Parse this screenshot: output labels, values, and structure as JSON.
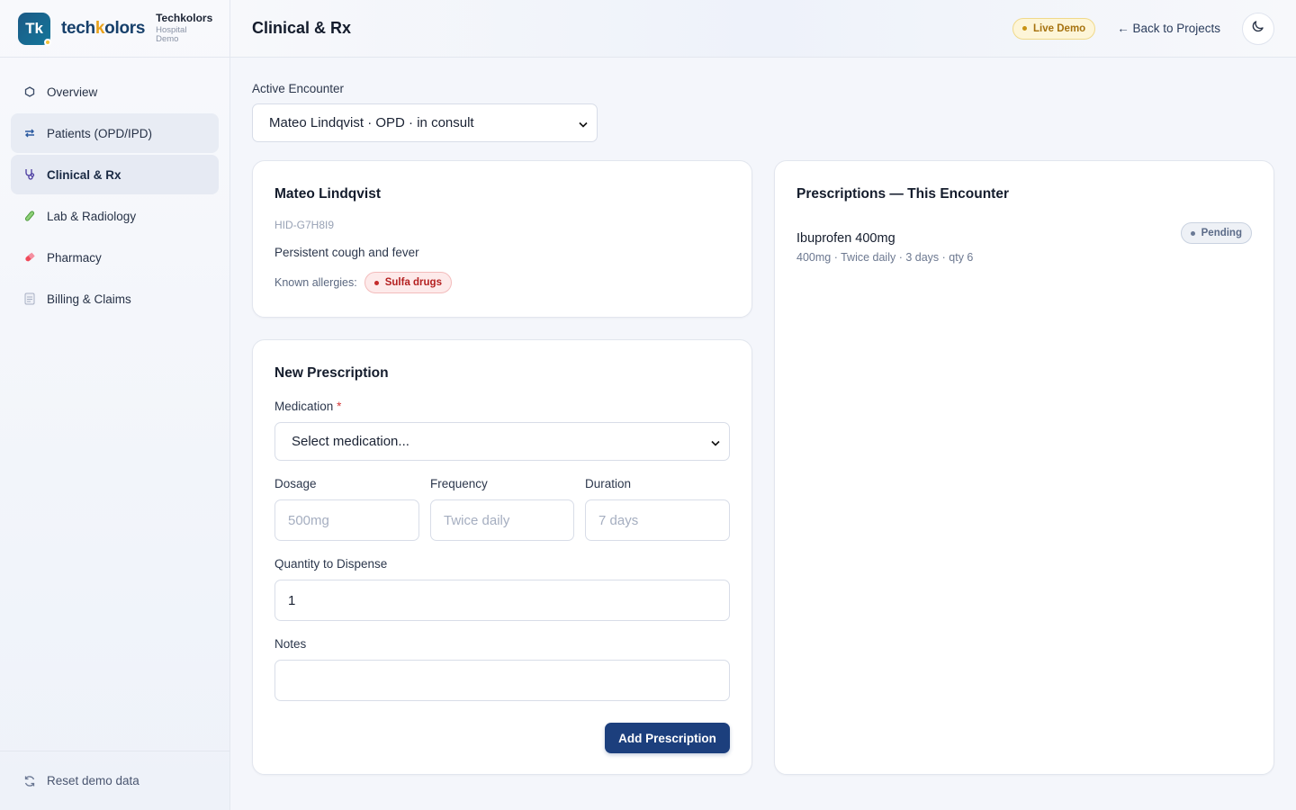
{
  "brand": {
    "logo_text": "Tk",
    "word_a": "tech",
    "word_k": "k",
    "word_b": "olors",
    "org": "Techkolors",
    "sub1": "Hospital",
    "sub2": "Demo"
  },
  "sidebar": {
    "items": [
      {
        "label": "Overview",
        "icon": "hexagon-icon"
      },
      {
        "label": "Patients (OPD/IPD)",
        "icon": "transfer-arrows-icon"
      },
      {
        "label": "Clinical & Rx",
        "icon": "stethoscope-icon"
      },
      {
        "label": "Lab & Radiology",
        "icon": "test-tube-icon"
      },
      {
        "label": "Pharmacy",
        "icon": "pill-icon"
      },
      {
        "label": "Billing & Claims",
        "icon": "document-icon"
      }
    ],
    "reset_label": "Reset demo data"
  },
  "header": {
    "title": "Clinical & Rx",
    "live_badge": "Live Demo",
    "back_label": "← Back to Projects"
  },
  "encounter": {
    "label": "Active Encounter",
    "selected": "Mateo Lindqvist · OPD · in consult"
  },
  "patient": {
    "name": "Mateo Lindqvist",
    "hid": "HID-G7H8I9",
    "complaint": "Persistent cough and fever",
    "allergies_label": "Known allergies:",
    "allergy": "Sulfa drugs"
  },
  "form": {
    "title": "New Prescription",
    "medication_label": "Medication",
    "required_mark": "*",
    "medication_value": "Select medication...",
    "dosage_label": "Dosage",
    "dosage_placeholder": "500mg",
    "frequency_label": "Frequency",
    "frequency_placeholder": "Twice daily",
    "duration_label": "Duration",
    "duration_placeholder": "7 days",
    "quantity_label": "Quantity to Dispense",
    "quantity_value": "1",
    "notes_label": "Notes",
    "notes_value": "",
    "submit_label": "Add Prescription"
  },
  "prescriptions": {
    "title": "Prescriptions — This Encounter",
    "items": [
      {
        "name": "Ibuprofen 400mg",
        "detail": "400mg · Twice daily · 3 days · qty 6",
        "status": "Pending"
      }
    ]
  },
  "colors": {
    "primary": "#1c3f7d",
    "brand_accent": "#e9a21b",
    "allergy_red": "#b42020",
    "live_badge": "#a6720f"
  }
}
